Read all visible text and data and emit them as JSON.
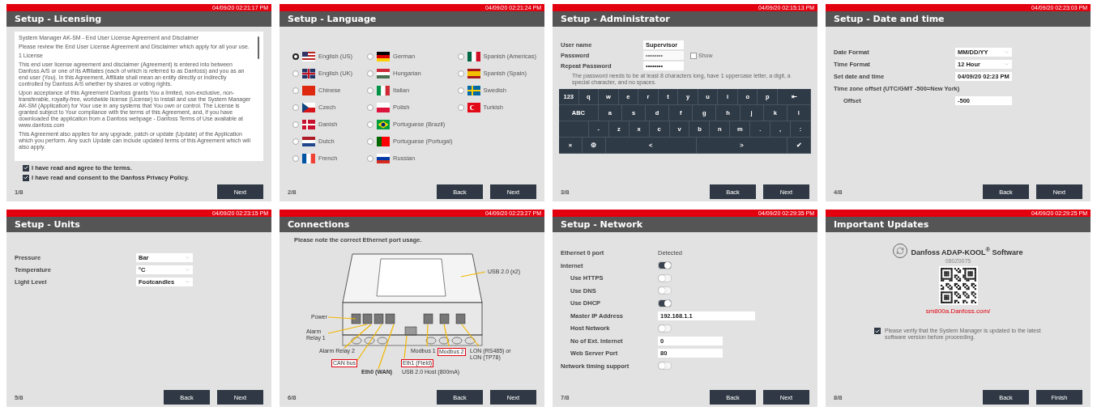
{
  "screens": [
    {
      "kind": "licensing",
      "timestamp": "04/09/20 02:21:17 PM",
      "title": "Setup - Licensing",
      "page": "1/8",
      "buttons": [
        "Next"
      ],
      "license_text": [
        "System Manager AK-SM - End User License Agreement and Disclaimer",
        "Please review the End User License Agreement and Disclaimer which apply for all your use.",
        "1 License",
        "This end user license agreement and disclaimer (Agreement) is entered into between Danfoss A/S or one of its Affiliates (each of which is referred to as Danfoss) and you as an end user (You). In this Agreement, Affiliate shall mean an entity directly or indirectly controlled by Danfoss A/S whether by shares or voting rights.",
        "Upon acceptance of this Agreement Danfoss grants You a limited, non-exclusive, non-transferable, royalty-free, worldwide license (License) to install and use the System Manager AK-SM (Application) for Your use in any systems that You own or control. The License is granted subject to Your compliance with the terms of this Agreement, and, if you have downloaded the application from a Danfoss webpage - Danfoss Terms of Use available at www.danfoss.com",
        "This Agreement also applies for any upgrade, patch or update (Update) of the Application which you perform. Any such Update can include updated terms of this Agreement which will also apply."
      ],
      "checkboxes": [
        {
          "label": "I have read and agree to the terms.",
          "checked": true
        },
        {
          "label": "I have read and consent to the Danfoss Privacy Policy.",
          "checked": true
        }
      ]
    },
    {
      "kind": "language",
      "timestamp": "04/09/20 02:21:24 PM",
      "title": "Setup - Language",
      "page": "2/8",
      "buttons": [
        "Back",
        "Next"
      ],
      "languages": [
        {
          "label": "English (US)",
          "selected": true
        },
        {
          "label": "English (UK)",
          "selected": false
        },
        {
          "label": "Chinese",
          "selected": false
        },
        {
          "label": "Czech",
          "selected": false
        },
        {
          "label": "Danish",
          "selected": false
        },
        {
          "label": "Dutch",
          "selected": false
        },
        {
          "label": "French",
          "selected": false
        },
        {
          "label": "German",
          "selected": false
        },
        {
          "label": "Hungarian",
          "selected": false
        },
        {
          "label": "Italian",
          "selected": false
        },
        {
          "label": "Polish",
          "selected": false
        },
        {
          "label": "Portuguese (Brazil)",
          "selected": false
        },
        {
          "label": "Portuguese (Portugal)",
          "selected": false
        },
        {
          "label": "Russian",
          "selected": false
        },
        {
          "label": "Spanish (Americas)",
          "selected": false
        },
        {
          "label": "Spanish (Spain)",
          "selected": false
        },
        {
          "label": "Swedish",
          "selected": false
        },
        {
          "label": "Turkish",
          "selected": false
        }
      ]
    },
    {
      "kind": "administrator",
      "timestamp": "04/09/20 02:15:13 PM",
      "title": "Setup - Administrator",
      "page": "3/8",
      "buttons": [
        "Back",
        "Next"
      ],
      "fields": [
        {
          "label": "User name",
          "value": "Supervisor",
          "disabled": false
        },
        {
          "label": "Password",
          "value": "••••••••",
          "disabled": true
        },
        {
          "label": "Repeat Password",
          "value": "••••••••",
          "disabled": false
        }
      ],
      "show": {
        "label": "Show",
        "checked": false
      },
      "hint": "The password needs to be at least 8 characters long, have 1 uppercase letter, a digit, a special character, and no spaces.",
      "keyboard": [
        [
          {
            "kind": "key",
            "label": "123"
          },
          {
            "kind": "key",
            "label": "q"
          },
          {
            "kind": "key",
            "label": "w"
          },
          {
            "kind": "key",
            "label": "e"
          },
          {
            "kind": "key",
            "label": "r"
          },
          {
            "kind": "key",
            "label": "t"
          },
          {
            "kind": "key",
            "label": "y"
          },
          {
            "kind": "key",
            "label": "u"
          },
          {
            "kind": "key",
            "label": "i"
          },
          {
            "kind": "key",
            "label": "o"
          },
          {
            "kind": "key",
            "label": "p"
          },
          {
            "kind": "wide",
            "label": "⇤"
          }
        ],
        [
          {
            "kind": "wide",
            "label": "ABC"
          },
          {
            "kind": "key",
            "label": "a"
          },
          {
            "kind": "key",
            "label": "s"
          },
          {
            "kind": "key",
            "label": "d"
          },
          {
            "kind": "key",
            "label": "f"
          },
          {
            "kind": "key",
            "label": "g"
          },
          {
            "kind": "key",
            "label": "h"
          },
          {
            "kind": "key",
            "label": "j"
          },
          {
            "kind": "key",
            "label": "k"
          },
          {
            "kind": "key",
            "label": "l"
          }
        ],
        [
          {
            "kind": "blank"
          },
          {
            "kind": "key",
            "label": "-"
          },
          {
            "kind": "key",
            "label": "z"
          },
          {
            "kind": "key",
            "label": "x"
          },
          {
            "kind": "key",
            "label": "c"
          },
          {
            "kind": "key",
            "label": "v"
          },
          {
            "kind": "key",
            "label": "b"
          },
          {
            "kind": "key",
            "label": "n"
          },
          {
            "kind": "key",
            "label": "m"
          },
          {
            "kind": "key",
            "label": "."
          },
          {
            "kind": "key",
            "label": ","
          },
          {
            "kind": "key",
            "label": ":"
          }
        ],
        [
          {
            "kind": "key",
            "label": "×"
          },
          {
            "kind": "key",
            "label": "⚙"
          },
          {
            "kind": "space",
            "label": "<"
          },
          {
            "kind": "space",
            "label": ">"
          },
          {
            "kind": "key",
            "label": "✔"
          }
        ]
      ]
    },
    {
      "kind": "form",
      "timestamp": "04/09/20 02:23:03 PM",
      "title": "Setup - Date and time",
      "page": "4/8",
      "buttons": [
        "Back",
        "Next"
      ],
      "fields": [
        {
          "kind": "select",
          "label": "Date Format",
          "value": "MM/DD/YY"
        },
        {
          "kind": "select",
          "label": "Time Format",
          "value": "12 Hour"
        },
        {
          "kind": "input",
          "label": "Set date and time",
          "value": "04/09/20 02:23 PM"
        },
        {
          "kind": "heading",
          "label": "Time zone offset (UTC/GMT -500=New York)",
          "children": [
            {
              "kind": "input",
              "label": "Offset",
              "value": "-500"
            }
          ]
        }
      ]
    },
    {
      "kind": "form",
      "timestamp": "04/09/20 02:23:15 PM",
      "title": "Setup - Units",
      "page": "5/8",
      "buttons": [
        "Back",
        "Next"
      ],
      "fields": [
        {
          "kind": "select",
          "label": "Pressure",
          "value": "Bar"
        },
        {
          "kind": "select",
          "label": "Temperature",
          "value": "°C"
        },
        {
          "kind": "select",
          "label": "Light Level",
          "value": "Footcandles"
        }
      ]
    },
    {
      "kind": "connections",
      "timestamp": "04/09/20 02:23:27 PM",
      "title": "Connections",
      "page": "6/8",
      "buttons": [
        "Back",
        "Next"
      ],
      "instruction": "Please note the correct Ethernet port usage.",
      "labels": [
        {
          "text": "USB 2.0 (x2)",
          "kind": "plain"
        },
        {
          "text": "Power",
          "kind": "plain"
        },
        {
          "text": "Alarm Relay 1",
          "kind": "plain"
        },
        {
          "text": "Alarm Relay 2",
          "kind": "plain"
        },
        {
          "text": "Modbus 1",
          "kind": "plain"
        },
        {
          "text": "Modbus 2",
          "kind": "boxed"
        },
        {
          "text": "LON (RS485) or LON (TP78)",
          "kind": "plain"
        },
        {
          "text": "CAN bus",
          "kind": "boxed"
        },
        {
          "text": "Eth1 (Field)",
          "kind": "boxed"
        },
        {
          "text": "Eth0 (WAN)",
          "kind": "bold"
        },
        {
          "text": "USB 2.0 Host (800mA)",
          "kind": "plain"
        }
      ]
    },
    {
      "kind": "network",
      "timestamp": "04/09/20 02:29:35 PM",
      "title": "Setup - Network",
      "page": "7/8",
      "buttons": [
        "Back",
        "Next"
      ],
      "rows": [
        {
          "kind": "status",
          "label": "Ethernet 0 port",
          "value": "Detected"
        },
        {
          "kind": "toggle",
          "label": "Internet",
          "on": true,
          "children": [
            {
              "kind": "toggle",
              "label": "Use HTTPS",
              "on": false
            },
            {
              "kind": "toggle",
              "label": "Use DNS",
              "on": false
            },
            {
              "kind": "toggle",
              "label": "Use DHCP",
              "on": true
            },
            {
              "kind": "input",
              "label": "Master IP Address",
              "value": "192.168.1.1"
            },
            {
              "kind": "toggle",
              "label": "Host Network",
              "on": false
            },
            {
              "kind": "input",
              "label": "No of Ext. Internet",
              "value": "0"
            },
            {
              "kind": "input",
              "label": "Web Server Port",
              "value": "80"
            }
          ]
        },
        {
          "kind": "toggle",
          "label": "Network timing support",
          "on": false
        }
      ]
    },
    {
      "kind": "updates",
      "timestamp": "04/09/20 02:29:25 PM",
      "title": "Important Updates",
      "page": "8/8",
      "buttons": [
        "Back",
        "Finish"
      ],
      "product": "Danfoss ADAP-KOOL$^{®}$ Software",
      "code": "080Z0075",
      "url": "sm800a.Danfoss.com/",
      "confirm": {
        "label": "Please verify that the System Manager is updated to the latest software version before proceeding.",
        "checked": true
      }
    }
  ]
}
